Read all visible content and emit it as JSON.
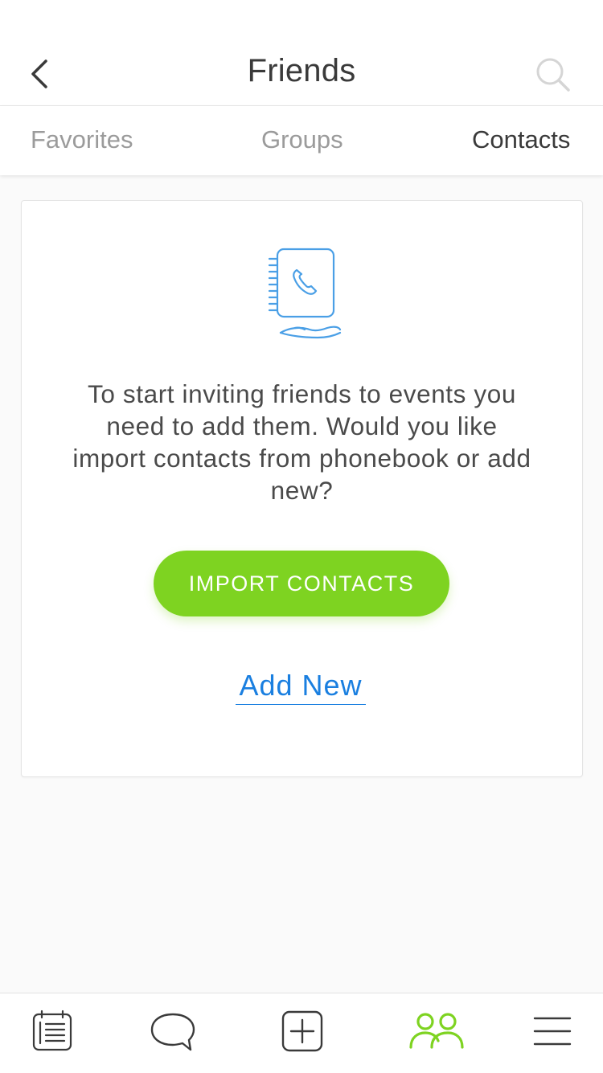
{
  "header": {
    "title": "Friends"
  },
  "tabs": [
    {
      "label": "Favorites",
      "active": false
    },
    {
      "label": "Groups",
      "active": false
    },
    {
      "label": "Contacts",
      "active": true
    }
  ],
  "empty_state": {
    "illustration": "phonebook-hand-icon",
    "message": "To start inviting friends to events you need to add them. Would you like import contacts from phonebook or add new?",
    "primary_button": "IMPORT CONTACTS",
    "secondary_link": "Add New"
  },
  "bottom_nav": [
    {
      "name": "events-list-icon",
      "active": false
    },
    {
      "name": "chat-bubble-icon",
      "active": false
    },
    {
      "name": "add-square-icon",
      "active": false
    },
    {
      "name": "friends-icon",
      "active": true
    },
    {
      "name": "hamburger-menu-icon",
      "active": false
    }
  ],
  "colors": {
    "accent_green": "#7ed321",
    "link_blue": "#1a7fe0",
    "illustration_blue": "#4a9fe6",
    "icon_dark": "#3a3a3a",
    "tab_inactive": "#9b9b9b"
  }
}
